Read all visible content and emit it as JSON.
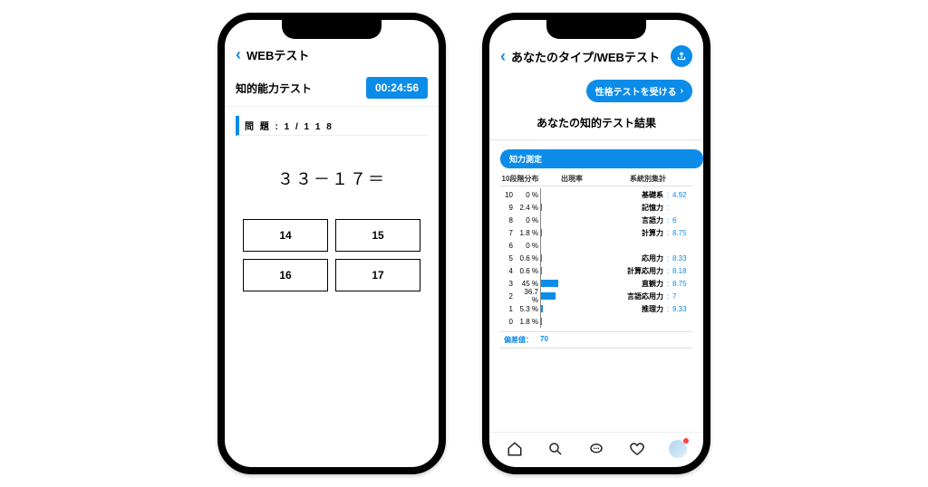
{
  "colors": {
    "accent": "#0c8ce9"
  },
  "phone1": {
    "header_title": "WEBテスト",
    "sub_title": "知的能力テスト",
    "timer": "00:24:56",
    "progress": "問 題 : 1  /  1 1 8",
    "question": "３３－１７＝",
    "answers": [
      "14",
      "15",
      "16",
      "17"
    ]
  },
  "phone2": {
    "header_title": "あなたのタイプ/WEBテスト",
    "cta_label": "性格テストを受ける",
    "result_title": "あなたの知的テスト結果",
    "section_chip": "知力測定",
    "table_headers": {
      "dist": "10段階分布",
      "rate": "出現率",
      "agg": "系統別集計"
    },
    "distribution": [
      {
        "level": 10,
        "pct": "0 %",
        "bar": 0
      },
      {
        "level": 9,
        "pct": "2.4 %",
        "bar": 2.4
      },
      {
        "level": 8,
        "pct": "0 %",
        "bar": 0
      },
      {
        "level": 7,
        "pct": "1.8 %",
        "bar": 1.8
      },
      {
        "level": 6,
        "pct": "0 %",
        "bar": 0
      },
      {
        "level": 5,
        "pct": "0.6 %",
        "bar": 0.6
      },
      {
        "level": 4,
        "pct": "0.6 %",
        "bar": 0.6
      },
      {
        "level": 3,
        "pct": "45 %",
        "bar": 45
      },
      {
        "level": 2,
        "pct": "36.7 %",
        "bar": 36.7
      },
      {
        "level": 1,
        "pct": "5.3 %",
        "bar": 5.3
      },
      {
        "level": 0,
        "pct": "1.8 %",
        "bar": 1.8
      }
    ],
    "categories": [
      {
        "label": "基礎系",
        "value": "4.92",
        "bold": true
      },
      {
        "label": "記憶力",
        "value": ""
      },
      {
        "label": "言語力",
        "value": "6"
      },
      {
        "label": "計算力",
        "value": "8.75"
      },
      {
        "label": "",
        "value": ""
      },
      {
        "label": "応用力",
        "value": "8.33",
        "bold": true
      },
      {
        "label": "計算応用力",
        "value": "8.18"
      },
      {
        "label": "直観力",
        "value": "8.75"
      },
      {
        "label": "言語応用力",
        "value": "7"
      },
      {
        "label": "推理力",
        "value": "9.33"
      },
      {
        "label": "",
        "value": ""
      }
    ],
    "deviation": {
      "label": "偏差値：",
      "value": "70"
    },
    "tabs": [
      "home",
      "search",
      "chat",
      "heart",
      "avatar"
    ]
  }
}
